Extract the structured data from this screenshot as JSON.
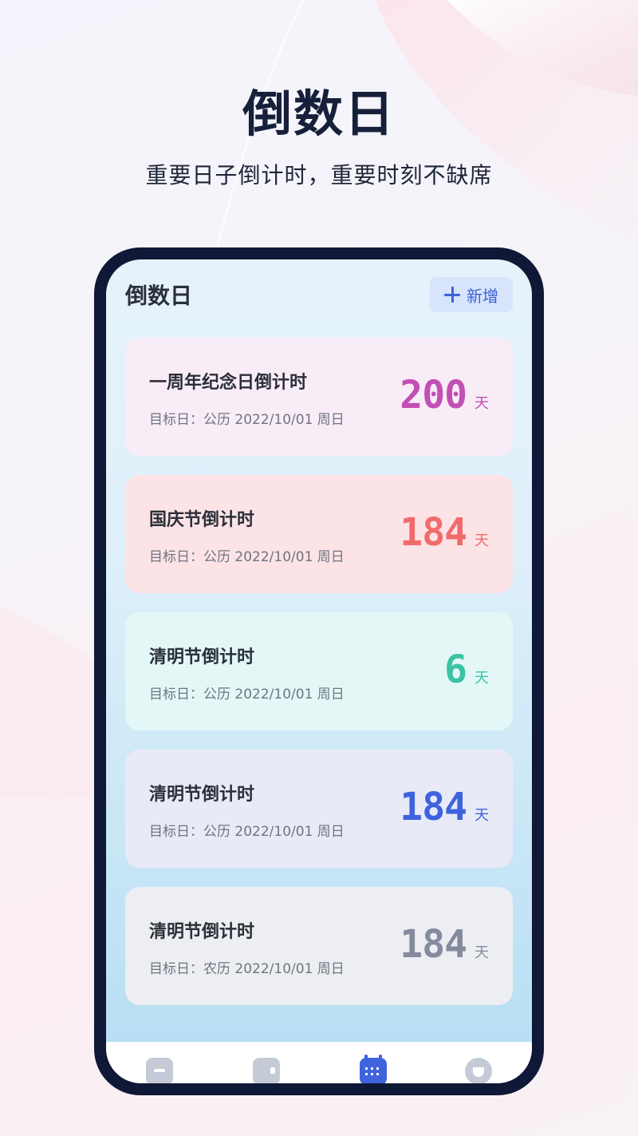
{
  "promo": {
    "title": "倒数日",
    "subtitle": "重要日子倒计时，重要时刻不缺席"
  },
  "screen": {
    "title": "倒数日",
    "add_label": "新增"
  },
  "events": [
    {
      "title": "一周年纪念日倒计时",
      "date": "目标日：公历 2022/10/01 周日",
      "count": "200",
      "unit": "天",
      "bg": "#f8ecf6",
      "color": "#c24fb4"
    },
    {
      "title": "国庆节倒计时",
      "date": "目标日：公历 2022/10/01 周日",
      "count": "184",
      "unit": "天",
      "bg": "#fbe3e6",
      "color": "#f26b6b"
    },
    {
      "title": "清明节倒计时",
      "date": "目标日：公历 2022/10/01 周日",
      "count": "6",
      "unit": "天",
      "bg": "#e3f8f6",
      "color": "#3cc2a4"
    },
    {
      "title": "清明节倒计时",
      "date": "目标日：公历 2022/10/01 周日",
      "count": "184",
      "unit": "天",
      "bg": "#e8eaf8",
      "color": "#3f63de"
    },
    {
      "title": "清明节倒计时",
      "date": "目标日：农历 2022/10/01 周日",
      "count": "184",
      "unit": "天",
      "bg": "#edeef2",
      "color": "#848b9e"
    }
  ],
  "tabbar": {
    "icons": [
      "list-icon",
      "wallet-icon",
      "calendar-icon",
      "profile-icon"
    ],
    "active": "calendar-icon"
  }
}
